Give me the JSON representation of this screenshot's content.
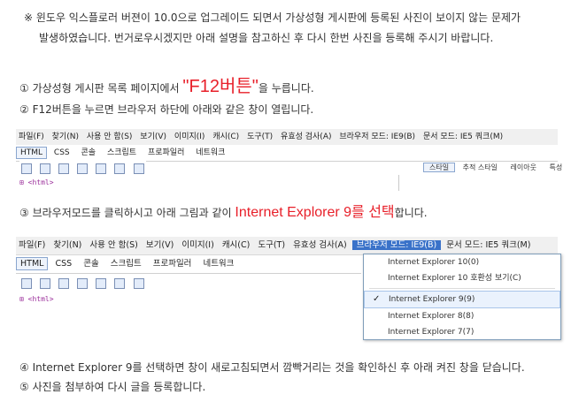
{
  "notice": {
    "line1": "※ 윈도우 익스플로러 버젼이 10.0으로 업그레이드 되면서 가상성형 게시판에 등록된 사진이 보이지 않는 문제가",
    "line2": "발생하였습니다. 번거로우시겠지만 아래 설명을 참고하신 후 다시 한번 사진을 등록해 주시기 바랍니다."
  },
  "steps": {
    "s1_pre": "① 가상성형 게시판 목록 페이지에서",
    "s1_emph": "\"F12버튼\"",
    "s1_post": "을 누릅니다.",
    "s2": "② F12버튼을 누르면 브라우저 하단에 아래와 같은 창이 열립니다.",
    "s3_pre": "③ 브라우저모드를 클릭하시고 아래 그림과 같이",
    "s3_emph": "Internet Explorer 9를 선택",
    "s3_post": "합니다.",
    "s4": "④ Internet Explorer 9를 선택하면 창이 새로고침되면서 깜빡거리는 것을 확인하신 후 아래 켜진 창을 닫습니다.",
    "s5": "⑤ 사진을 첨부하여 다시 글을 등록합니다."
  },
  "devtools": {
    "menu": [
      "파일(F)",
      "찾기(N)",
      "사용 안 함(S)",
      "보기(V)",
      "이미지(I)",
      "캐시(C)",
      "도구(T)",
      "유효성 검사(A)"
    ],
    "browser_mode": "브라우저 모드: IE9(B)",
    "doc_mode": "문서 모드: IE5 쿼크(M)",
    "tabs": [
      "HTML",
      "CSS",
      "콘솔",
      "스크립트",
      "프로파일러",
      "네트워크"
    ],
    "right_tabs": [
      "스타일",
      "추적 스타일",
      "레이아웃",
      "특성"
    ],
    "html_node": "<html>",
    "dropdown": {
      "items": [
        {
          "label": "Internet Explorer 10(0)",
          "selected": false
        },
        {
          "label": "Internet Explorer 10 호환성 보기(C)",
          "selected": false
        },
        {
          "label": "Internet Explorer 9(9)",
          "selected": true
        },
        {
          "label": "Internet Explorer 8(8)",
          "selected": false
        },
        {
          "label": "Internet Explorer 7(7)",
          "selected": false
        }
      ],
      "check": "✓"
    }
  }
}
